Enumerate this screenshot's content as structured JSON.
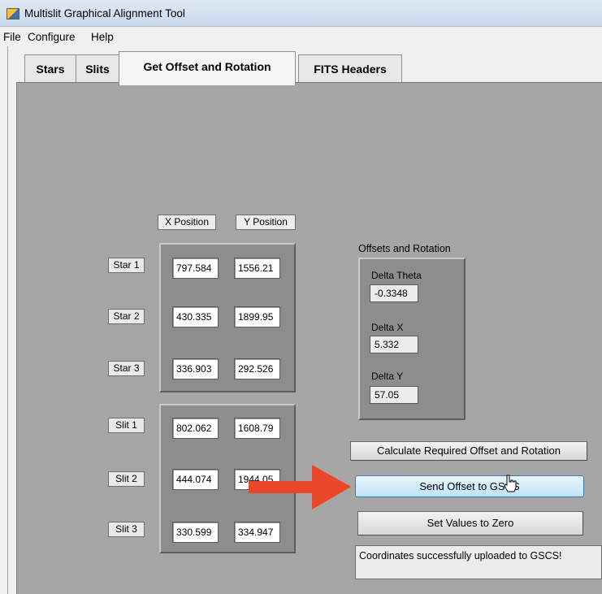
{
  "window": {
    "title": "Multislit Graphical Alignment Tool"
  },
  "menu": {
    "items": [
      "File",
      "Configure",
      "Help"
    ]
  },
  "tabs": [
    "Stars",
    "Slits",
    "Get Offset and Rotation",
    "FITS Headers"
  ],
  "positions": {
    "x_header": "X Position",
    "y_header": "Y Position",
    "stars": [
      {
        "label": "Star 1",
        "x": "797.584",
        "y": "1556.21"
      },
      {
        "label": "Star 2",
        "x": "430.335",
        "y": "1899.95"
      },
      {
        "label": "Star 3",
        "x": "336.903",
        "y": "292.526"
      }
    ],
    "slits": [
      {
        "label": "Slit 1",
        "x": "802.062",
        "y": "1608.79"
      },
      {
        "label": "Slit 2",
        "x": "444.074",
        "y": "1944.05"
      },
      {
        "label": "Slit 3",
        "x": "330.599",
        "y": "334.947"
      }
    ]
  },
  "offsets": {
    "title": "Offsets and Rotation",
    "delta_theta_label": "Delta Theta",
    "delta_theta": "-0.3348",
    "delta_x_label": "Delta X",
    "delta_x": "5.332",
    "delta_y_label": "Delta Y",
    "delta_y": "57.05"
  },
  "buttons": {
    "calculate": "Calculate  Required Offset and Rotation",
    "send": "Send Offset to GSCS",
    "zero": "Set Values to Zero"
  },
  "status": {
    "message": "Coordinates successfully uploaded to GSCS!"
  },
  "colors": {
    "panel_bg": "#a6a6a6",
    "cluster_bg": "#8d8d8d",
    "arrow": "#e8472a",
    "hover_button": "#bfe3f8"
  },
  "icons": {
    "app": "labview-app-icon",
    "arrow": "red-right-arrow-annotation",
    "cursor": "hand-pointer-cursor"
  }
}
